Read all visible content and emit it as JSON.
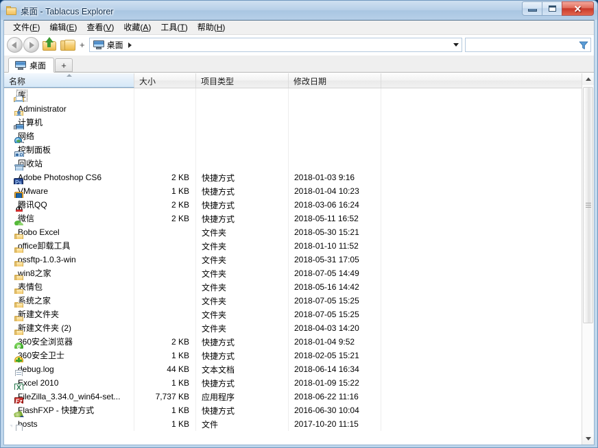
{
  "window": {
    "title": "桌面 - Tablacus Explorer",
    "icon": "folder-icon",
    "minimize_label": "",
    "maximize_label": "",
    "close_label": "✕"
  },
  "menubar": {
    "items": [
      {
        "text": "文件(F)",
        "name": "menu-file"
      },
      {
        "text": "编辑(E)",
        "name": "menu-edit"
      },
      {
        "text": "查看(V)",
        "name": "menu-view"
      },
      {
        "text": "收藏(A)",
        "name": "menu-favorites"
      },
      {
        "text": "工具(T)",
        "name": "menu-tools"
      },
      {
        "text": "帮助(H)",
        "name": "menu-help"
      }
    ]
  },
  "toolbar": {
    "back_tooltip": "后退",
    "forward_tooltip": "前进",
    "up_tooltip": "向上",
    "folder_tooltip": "文件夹",
    "plus_label": "+",
    "breadcrumb": {
      "text": "桌面"
    },
    "search": {
      "value": "",
      "placeholder": ""
    }
  },
  "tabbar": {
    "tabs": [
      {
        "label": "桌面",
        "icon": "monitor-icon",
        "active": true
      }
    ],
    "new_tab_label": "+"
  },
  "listview": {
    "columns": [
      {
        "label": "名称",
        "key": "name",
        "sorted": true,
        "sort_dir": "asc"
      },
      {
        "label": "大小",
        "key": "size",
        "sorted": false
      },
      {
        "label": "项目类型",
        "key": "type",
        "sorted": false
      },
      {
        "label": "修改日期",
        "key": "date",
        "sorted": false
      }
    ],
    "rows": [
      {
        "name": "库",
        "size": "",
        "type": "",
        "date": "",
        "icon": "library-icon",
        "focused": true
      },
      {
        "name": "Administrator",
        "size": "",
        "type": "",
        "date": "",
        "icon": "user-folder-icon"
      },
      {
        "name": "计算机",
        "size": "",
        "type": "",
        "date": "",
        "icon": "computer-icon"
      },
      {
        "name": "网络",
        "size": "",
        "type": "",
        "date": "",
        "icon": "network-icon"
      },
      {
        "name": "控制面板",
        "size": "",
        "type": "",
        "date": "",
        "icon": "control-panel-icon"
      },
      {
        "name": "回收站",
        "size": "",
        "type": "",
        "date": "",
        "icon": "recycle-bin-icon"
      },
      {
        "name": "Adobe Photoshop CS6",
        "size": "2 KB",
        "type": "快捷方式",
        "date": "2018-01-03 9:16",
        "icon": "photoshop-icon"
      },
      {
        "name": "VMware",
        "size": "1 KB",
        "type": "快捷方式",
        "date": "2018-01-04 10:23",
        "icon": "vmware-icon"
      },
      {
        "name": "腾讯QQ",
        "size": "2 KB",
        "type": "快捷方式",
        "date": "2018-03-06 16:24",
        "icon": "qq-icon"
      },
      {
        "name": "微信",
        "size": "2 KB",
        "type": "快捷方式",
        "date": "2018-05-11 16:52",
        "icon": "wechat-icon"
      },
      {
        "name": "Bobo Excel",
        "size": "",
        "type": "文件夹",
        "date": "2018-05-30 15:21",
        "icon": "folder-icon"
      },
      {
        "name": "office卸载工具",
        "size": "",
        "type": "文件夹",
        "date": "2018-01-10 11:52",
        "icon": "folder-icon"
      },
      {
        "name": "ossftp-1.0.3-win",
        "size": "",
        "type": "文件夹",
        "date": "2018-05-31 17:05",
        "icon": "folder-icon"
      },
      {
        "name": "win8之家",
        "size": "",
        "type": "文件夹",
        "date": "2018-07-05 14:49",
        "icon": "folder-icon"
      },
      {
        "name": "表情包",
        "size": "",
        "type": "文件夹",
        "date": "2018-05-16 14:42",
        "icon": "folder-icon"
      },
      {
        "name": "系统之家",
        "size": "",
        "type": "文件夹",
        "date": "2018-07-05 15:25",
        "icon": "folder-icon"
      },
      {
        "name": "新建文件夹",
        "size": "",
        "type": "文件夹",
        "date": "2018-07-05 15:25",
        "icon": "folder-icon"
      },
      {
        "name": "新建文件夹 (2)",
        "size": "",
        "type": "文件夹",
        "date": "2018-04-03 14:20",
        "icon": "folder-icon"
      },
      {
        "name": "360安全浏览器",
        "size": "2 KB",
        "type": "快捷方式",
        "date": "2018-01-04 9:52",
        "icon": "360-browser-icon"
      },
      {
        "name": "360安全卫士",
        "size": "1 KB",
        "type": "快捷方式",
        "date": "2018-02-05 15:21",
        "icon": "360-guard-icon"
      },
      {
        "name": "debug.log",
        "size": "44 KB",
        "type": "文本文档",
        "date": "2018-06-14 16:34",
        "icon": "text-document-icon"
      },
      {
        "name": "Excel 2010",
        "size": "1 KB",
        "type": "快捷方式",
        "date": "2018-01-09 15:22",
        "icon": "excel-icon"
      },
      {
        "name": "FileZilla_3.34.0_win64-set...",
        "size": "7,737 KB",
        "type": "应用程序",
        "date": "2018-06-22 11:16",
        "icon": "filezilla-icon"
      },
      {
        "name": "FlashFXP - 快捷方式",
        "size": "1 KB",
        "type": "快捷方式",
        "date": "2016-06-30 10:04",
        "icon": "flashfxp-icon"
      },
      {
        "name": "hosts",
        "size": "1 KB",
        "type": "文件",
        "date": "2017-10-20 11:15",
        "icon": "file-icon"
      }
    ]
  },
  "scrollbar": {
    "up_label": "▲",
    "down_label": "▼"
  },
  "colors": {
    "title_bar": "#b8d0e8",
    "accent": "#1f6fa8",
    "close_button": "#c8392a",
    "folder": "#f5d07a",
    "window_border": "#6f96bd"
  }
}
